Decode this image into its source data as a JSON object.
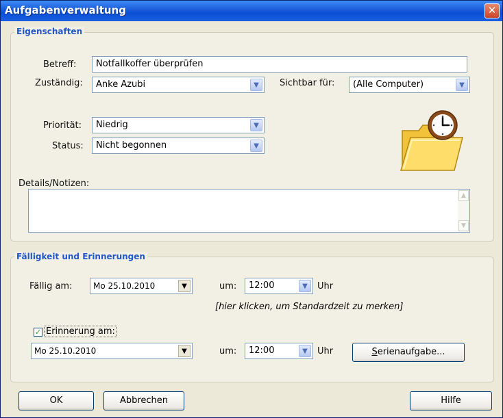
{
  "window": {
    "title": "Aufgabenverwaltung",
    "close_glyph": "✕"
  },
  "eigenschaften": {
    "title": "Eigenschaften",
    "betreff_label": "Betreff:",
    "betreff_value": "Notfallkoffer überprüfen",
    "zustaendig_label": "Zuständig:",
    "zustaendig_value": "Anke Azubi",
    "sichtbar_label": "Sichtbar für:",
    "sichtbar_value": "(Alle Computer)",
    "prioritaet_label": "Priorität:",
    "prioritaet_value": "Niedrig",
    "status_label": "Status:",
    "status_value": "Nicht begonnen",
    "details_label": "Details/Notizen:",
    "details_value": "",
    "icon": "folder-clock-icon"
  },
  "faelligkeit": {
    "title": "Fälligkeit und Erinnerungen",
    "faellig_label": "Fällig am:",
    "faellig_date": "Mo 25.10.2010",
    "um_label": "um:",
    "faellig_time": "12:00",
    "uhr_label": "Uhr",
    "hint": "[hier klicken, um Standardzeit zu merken]",
    "erinnerung_label": "Erinnerung am:",
    "erinnerung_checked": true,
    "erinnerung_date": "Mo 25.10.2010",
    "um2_label": "um:",
    "erinnerung_time": "12:00",
    "uhr2_label": "Uhr",
    "serien_button": "erienaufgabe...",
    "serien_mnemonic": "S"
  },
  "buttons": {
    "ok": "OK",
    "abbrechen": "Abbrechen",
    "hilfe": "Hilfe"
  },
  "colors": {
    "titlebar": "#0b4fd6",
    "group_title": "#2356c7",
    "dialog_bg": "#ece9d8"
  },
  "glyphs": {
    "dropdown_arrow": "▼",
    "checkmark": "✓",
    "scroll_up": "▲",
    "scroll_down": "▼"
  }
}
